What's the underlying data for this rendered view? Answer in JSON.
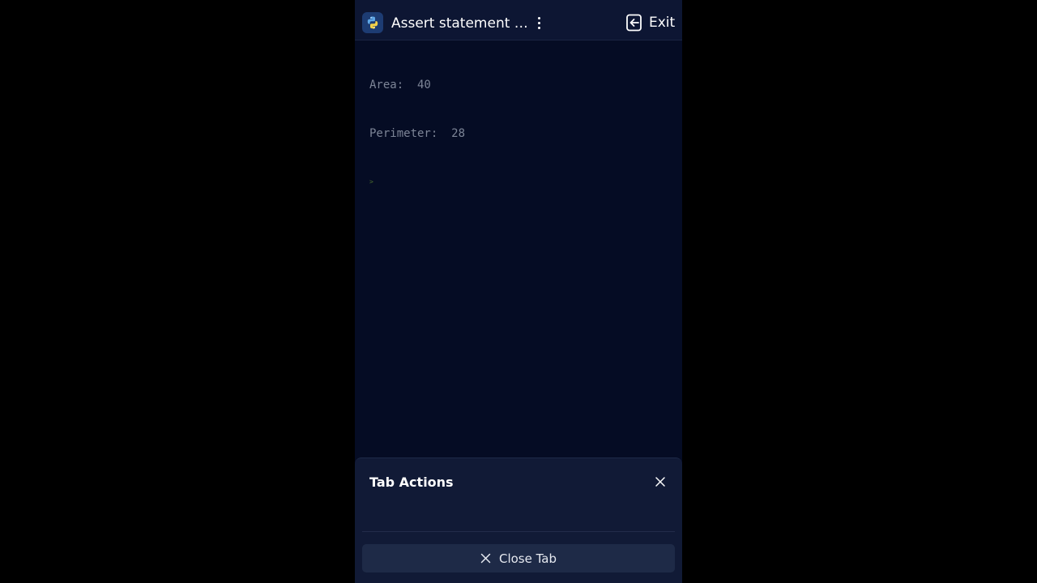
{
  "header": {
    "title": "Assert statement i...",
    "exit_label": "Exit",
    "app_icon": "python-icon",
    "menu_icon": "kebab-menu-icon",
    "exit_icon": "exit-icon"
  },
  "console": {
    "lines": [
      "Area:  40",
      "Perimeter:  28"
    ],
    "prompt": ">"
  },
  "sheet": {
    "title": "Tab Actions",
    "close_tab_label": "Close Tab"
  },
  "colors": {
    "background": "#000000",
    "app_bg": "#050c24",
    "topbar_bg": "#0d1633",
    "sheet_bg": "#111a36",
    "button_bg": "#1e2a47",
    "console_text": "#7d8597"
  }
}
